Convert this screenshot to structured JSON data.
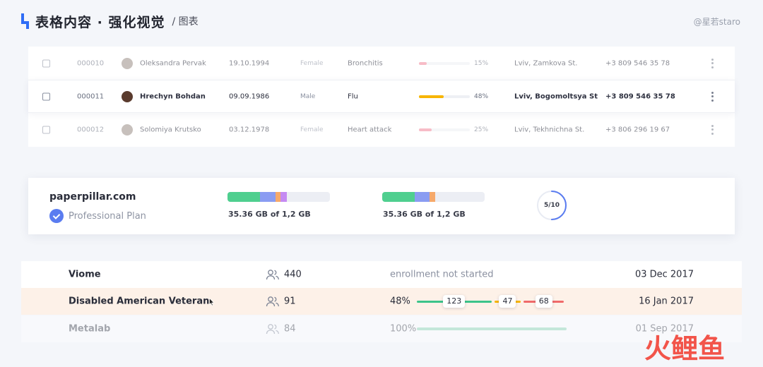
{
  "header": {
    "title": "表格内容 · 强化视觉",
    "subtitle": "/ 图表",
    "watermark": "@星若staro"
  },
  "patients": [
    {
      "id": "000010",
      "name": "Oleksandra Pervak",
      "dob": "19.10.1994",
      "gender": "Female",
      "diagnosis": "Bronchitis",
      "progress_label": "15%",
      "progress": 0.15,
      "progress_color": "#f2879a",
      "address": "Lviv, Zamkova St.",
      "phone": "+3 809 546 35 78"
    },
    {
      "id": "000011",
      "name": "Hrechyn Bohdan",
      "dob": "09.09.1986",
      "gender": "Male",
      "diagnosis": "Flu",
      "progress_label": "48%",
      "progress": 0.48,
      "progress_color": "#f7b500",
      "address": "Lviv, Bogomoltsya St",
      "phone": "+3 809 546 35 78"
    },
    {
      "id": "000012",
      "name": "Solomiya Krutsko",
      "dob": "03.12.1978",
      "gender": "Female",
      "diagnosis": "Heart attack",
      "progress_label": "25%",
      "progress": 0.25,
      "progress_color": "#f2879a",
      "address": "Lviv, Tekhnichna St.",
      "phone": "+3 806 296 19 67"
    }
  ],
  "storage": {
    "site": "paperpillar.com",
    "plan": "Professional Plan",
    "bars": [
      {
        "label": "35.36 GB of 1,2 GB",
        "segments": [
          {
            "share": 0.32,
            "color": "#4fcf8f"
          },
          {
            "share": 0.15,
            "color": "#8a9cf2"
          },
          {
            "share": 0.05,
            "color": "#f6a96b"
          },
          {
            "share": 0.06,
            "color": "#c58af2"
          }
        ]
      },
      {
        "label": "35.36 GB of 1,2 GB",
        "segments": [
          {
            "share": 0.32,
            "color": "#4fcf8f"
          },
          {
            "share": 0.14,
            "color": "#8a9cf2"
          },
          {
            "share": 0.06,
            "color": "#f6a96b"
          }
        ]
      }
    ],
    "counter": {
      "label": "5/10",
      "value": 5,
      "max": 10,
      "color": "#5a7cf0"
    }
  },
  "enrollments": [
    {
      "name": "Viome",
      "users": "440",
      "status": "enrollment not started",
      "date": "03 Dec 2017"
    },
    {
      "name": "Disabled American Veteran",
      "users": "91",
      "percent": "48%",
      "segments": [
        {
          "value": 123,
          "label": "123",
          "color": "#3cc48a"
        },
        {
          "value": 47,
          "label": "47",
          "color": "#f7b500"
        },
        {
          "value": 68,
          "label": "68",
          "color": "#f06a6a"
        }
      ],
      "date": "16 Jan 2017"
    },
    {
      "name": "Metalab",
      "users": "84",
      "percent": "100%",
      "date": "01 Sep 2017"
    }
  ],
  "logo": {
    "chars": [
      "火",
      "鲤",
      "鱼"
    ],
    "colors": [
      "#f2544a",
      "#f2544a",
      "#f2544a"
    ]
  }
}
